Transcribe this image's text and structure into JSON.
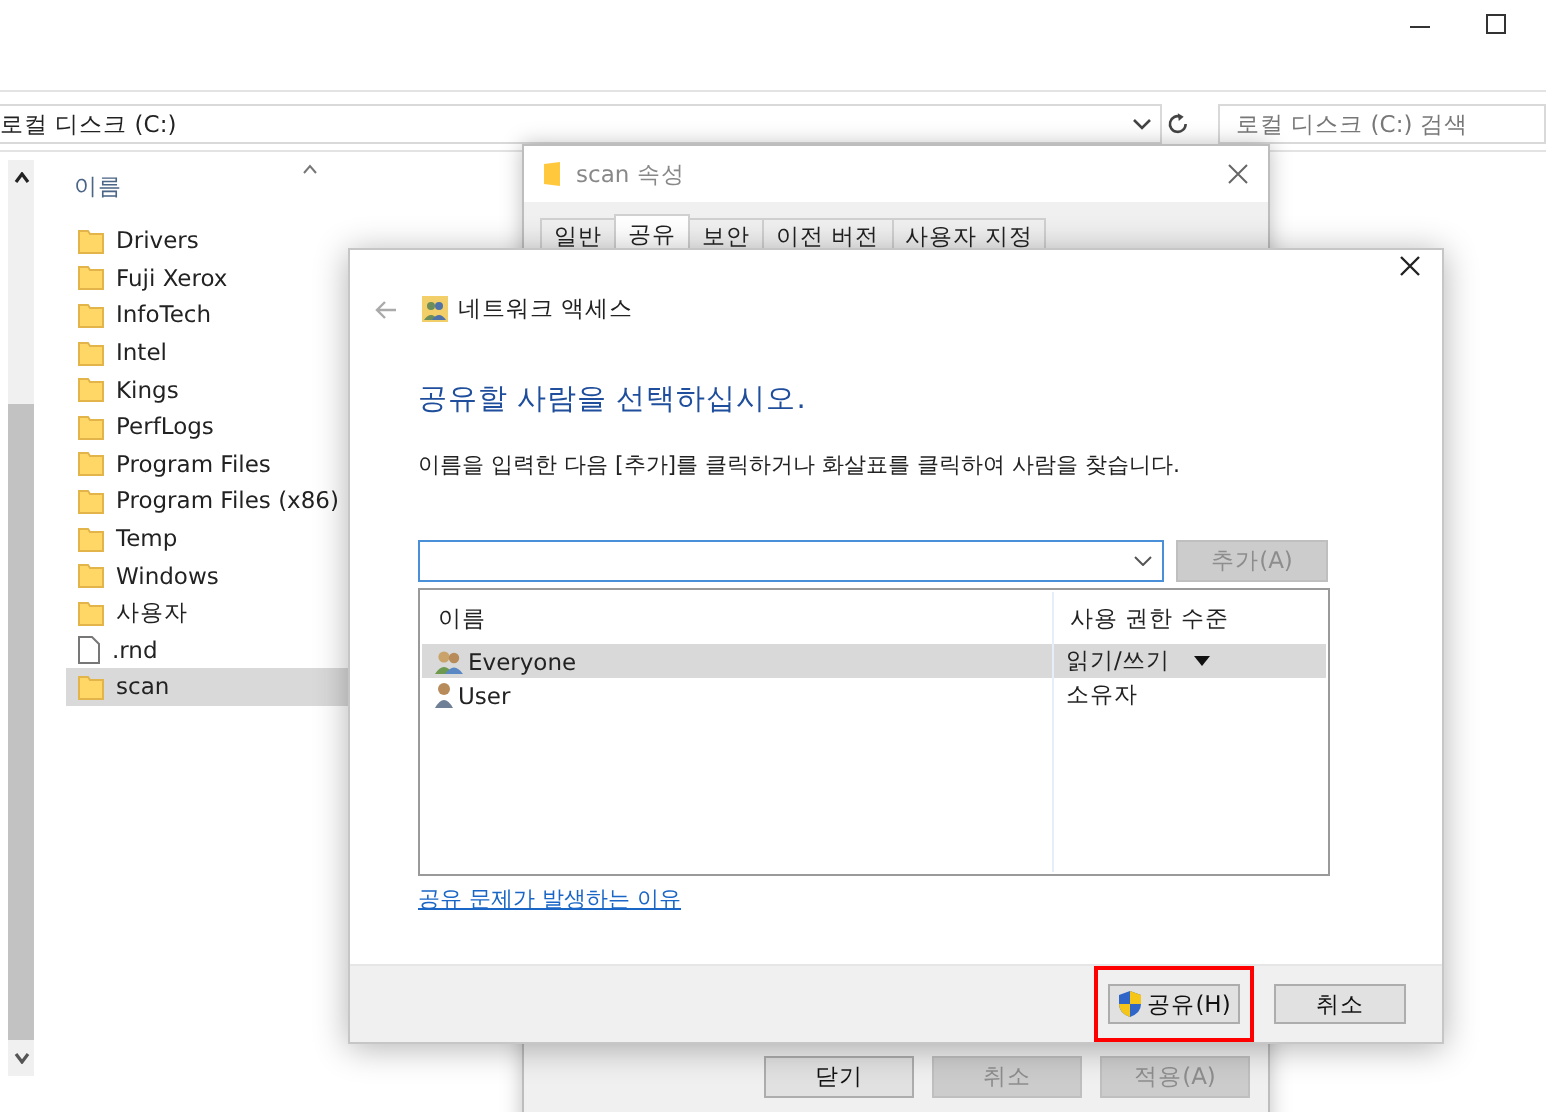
{
  "explorer": {
    "address": "로컬 디스크 (C:)",
    "search": {
      "placeholder": "로컬 디스크 (C:) 검색"
    },
    "column": "이름",
    "items": [
      {
        "name": "Drivers",
        "kind": "folder",
        "selected": false
      },
      {
        "name": "Fuji Xerox",
        "kind": "folder",
        "selected": false
      },
      {
        "name": "InfoTech",
        "kind": "folder",
        "selected": false
      },
      {
        "name": "Intel",
        "kind": "folder",
        "selected": false
      },
      {
        "name": "Kings",
        "kind": "folder",
        "selected": false
      },
      {
        "name": "PerfLogs",
        "kind": "folder",
        "selected": false
      },
      {
        "name": "Program Files",
        "kind": "folder",
        "selected": false
      },
      {
        "name": "Program Files (x86)",
        "kind": "folder",
        "selected": false
      },
      {
        "name": "Temp",
        "kind": "folder",
        "selected": false
      },
      {
        "name": "Windows",
        "kind": "folder",
        "selected": false
      },
      {
        "name": "사용자",
        "kind": "folder",
        "selected": false
      },
      {
        "name": ".rnd",
        "kind": "file",
        "selected": false
      },
      {
        "name": "scan",
        "kind": "folder",
        "selected": true
      }
    ]
  },
  "properties": {
    "title": "scan 속성",
    "tabs": [
      {
        "label": "일반",
        "selected": false
      },
      {
        "label": "공유",
        "selected": true
      },
      {
        "label": "보안",
        "selected": false
      },
      {
        "label": "이전 버전",
        "selected": false
      },
      {
        "label": "사용자 지정",
        "selected": false
      }
    ],
    "buttons": [
      {
        "label": "닫기",
        "disabled": false
      },
      {
        "label": "취소",
        "disabled": true
      },
      {
        "label": "적용(A)",
        "disabled": true
      }
    ]
  },
  "dialog": {
    "title": "네트워크 액세스",
    "heading": "공유할 사람을 선택하십시오.",
    "instruction": "이름을 입력한 다음 [추가]를 클릭하거나 화살표를 클릭하여 사람을 찾습니다.",
    "add_button": {
      "label": "추가(A)",
      "disabled": true
    },
    "columns": [
      "이름",
      "사용 권한 수준"
    ],
    "rows": [
      {
        "name": "Everyone",
        "kind": "group",
        "permission": "읽기/쓰기",
        "menu": true,
        "selected": true
      },
      {
        "name": "User",
        "kind": "user",
        "permission": "소유자",
        "menu": false,
        "selected": false
      }
    ],
    "link": "공유 문제가 발생하는 이유",
    "buttons": [
      {
        "label": "공유(H)",
        "kind": "shield",
        "highlighted": true
      },
      {
        "label": "취소",
        "kind": "plain",
        "highlighted": false
      }
    ]
  }
}
